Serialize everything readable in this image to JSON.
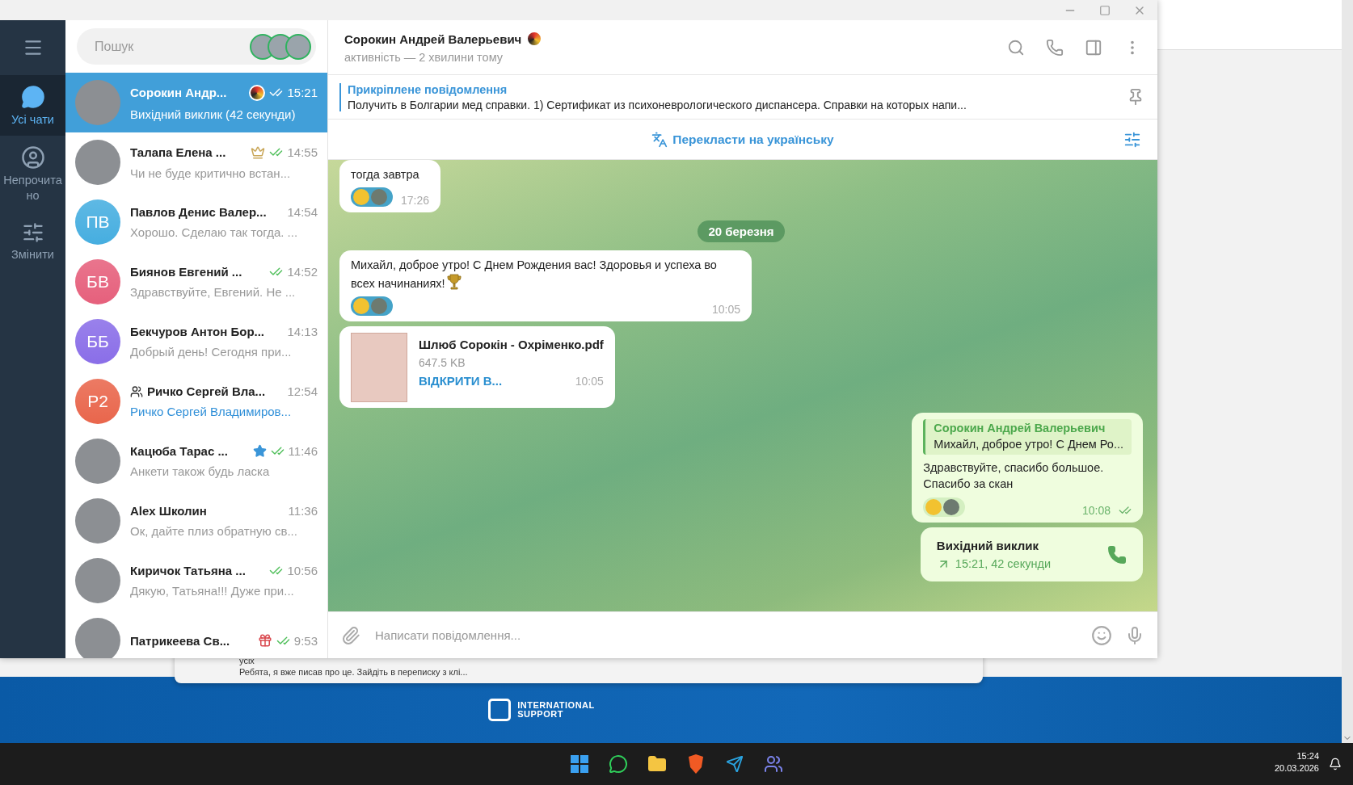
{
  "sidebar": {
    "folders": [
      {
        "kind": "chats",
        "label": "Усі чати",
        "selected": true
      },
      {
        "kind": "unread",
        "label": "Непрочитано",
        "selected": false
      },
      {
        "kind": "edit",
        "label": "Змінити",
        "selected": false
      }
    ]
  },
  "chat_list": {
    "search": {
      "placeholder": "Пошук"
    },
    "chats": [
      {
        "name": "Сорокин Андр...",
        "time": "15:21",
        "preview": "Вихідний виклик (42 секунди)",
        "selected": true,
        "read": true,
        "badge": {
          "kind": "logo"
        },
        "avatar": {
          "kind": "photo"
        }
      },
      {
        "name": "Талапа Елена ...",
        "time": "14:55",
        "preview": "Чи не буде критично встан...",
        "selected": false,
        "read": true,
        "badge": {
          "kind": "emblem"
        },
        "avatar": {
          "kind": "photo"
        }
      },
      {
        "name": "Павлов Денис Валер...",
        "time": "14:54",
        "preview": "Хорошо. Сделаю так тогда. ...",
        "selected": false,
        "read": false,
        "avatar": {
          "kind": "initials",
          "initials": "ПВ",
          "color": "#46aee0"
        }
      },
      {
        "name": "Биянов Евгений ...",
        "time": "14:52",
        "preview": "Здравствуйте, Евгений. Не ...",
        "selected": false,
        "read": true,
        "avatar": {
          "kind": "initials",
          "initials": "БВ",
          "color": "#e6607c"
        }
      },
      {
        "name": "Бекчуров Антон Бор...",
        "time": "14:13",
        "preview": "Добрый день! Сегодня при...",
        "selected": false,
        "read": false,
        "avatar": {
          "kind": "initials",
          "initials": "ББ",
          "color": "#8a6ee8"
        }
      },
      {
        "name": "Ричко Сергей Вла...",
        "time": "12:54",
        "preview": "Ричко Сергей Владимиров...",
        "selected": false,
        "read": false,
        "group": true,
        "preview_highlight": true,
        "avatar": {
          "kind": "initials",
          "initials": "Р2",
          "color": "#e9664c"
        }
      },
      {
        "name": "Кацюба Тарас ...",
        "time": "11:46",
        "preview": "Анкети також будь ласка",
        "selected": false,
        "read": true,
        "badge": {
          "kind": "star"
        },
        "avatar": {
          "kind": "photo"
        }
      },
      {
        "name": "Alex Школин",
        "time": "11:36",
        "preview": "Ок, дайте плиз обратную св...",
        "selected": false,
        "read": false,
        "avatar": {
          "kind": "photo"
        }
      },
      {
        "name": "Киричок Татьяна ...",
        "time": "10:56",
        "preview": "Дякую,  Татьяна!!! Дуже при...",
        "selected": false,
        "read": true,
        "avatar": {
          "kind": "photo"
        }
      },
      {
        "name": "Патрикеева Св...",
        "time": "9:53",
        "selected": false,
        "read": true,
        "badge": {
          "kind": "gift"
        },
        "avatar": {
          "kind": "photo"
        }
      }
    ]
  },
  "chat": {
    "title": "Сорокин Андрей Валерьевич",
    "status": "активність — 2 хвилини тому",
    "pinned": {
      "title": "Прикріплене повідомлення",
      "text": "Получить в Болгарии мед справки.  1) Сертификат из психоневрологического диспансера. Справки на которых напи..."
    },
    "translate": "Перекласти на українську",
    "messages": [
      {
        "kind": "text",
        "outgoing": false,
        "text": "тогда завтра",
        "time": "17:26",
        "reacted": true
      },
      {
        "kind": "date",
        "text": "20 березня"
      },
      {
        "kind": "text",
        "outgoing": false,
        "text": "Михайл, доброе утро! С Днем Рождения вас! Здоровья и успеха во всех начинаниях!",
        "trophy": true,
        "time": "10:05",
        "reacted": true
      },
      {
        "kind": "file",
        "outgoing": false,
        "name": "Шлюб Сорокін - Охріменко.pdf",
        "size": "647.5 KB",
        "action": "ВІДКРИТИ В...",
        "time": "10:05"
      },
      {
        "kind": "text",
        "outgoing": true,
        "reply": {
          "author": "Сорокин Андрей Валерьевич",
          "text": "Михайл, доброе утро! С Днем Ро..."
        },
        "text": "Здравствуйте, спасибо большое.\nСпасибо за скан",
        "time": "10:08",
        "read": true,
        "reacted": true
      },
      {
        "kind": "call",
        "outgoing": true,
        "title": "Вихідний виклик",
        "detail": "15:21, 42 секунди"
      }
    ],
    "composer": {
      "placeholder": "Написати повідомлення..."
    }
  },
  "background_window": {
    "lines": [
      "усіх",
      "Ребята, я вже писав про це. Зайдіть в переписку з клі..."
    ]
  },
  "banner": {
    "logo_lines": [
      "INTERNATIONAL",
      "SUPPORT"
    ]
  },
  "taskbar": {
    "time": "15:24",
    "date": "20.03.2026"
  }
}
